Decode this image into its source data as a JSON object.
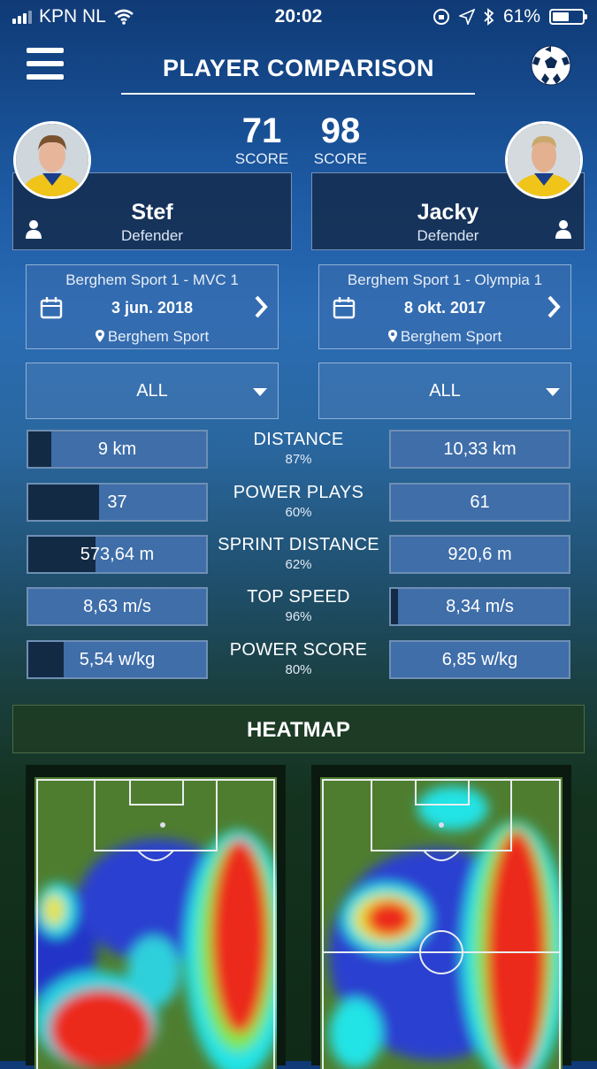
{
  "status_bar": {
    "carrier": "KPN NL",
    "time": "20:02",
    "battery": "61%",
    "battery_level": 0.61
  },
  "header": {
    "title": "PLAYER COMPARISON"
  },
  "players": [
    {
      "name": "Stef",
      "position": "Defender",
      "score": "71",
      "score_label": "SCORE",
      "match": {
        "title": "Berghem Sport 1 - MVC 1",
        "date": "3 jun. 2018",
        "location": "Berghem Sport"
      },
      "filter": "ALL"
    },
    {
      "name": "Jacky",
      "position": "Defender",
      "score": "98",
      "score_label": "SCORE",
      "match": {
        "title": "Berghem Sport 1 - Olympia 1",
        "date": "8 okt. 2017",
        "location": "Berghem Sport"
      },
      "filter": "ALL"
    }
  ],
  "stats": [
    {
      "label": "DISTANCE",
      "percent": "87%",
      "left": "9 km",
      "right": "10,33 km",
      "left_fill": 0.87,
      "right_fill": 1.0
    },
    {
      "label": "POWER PLAYS",
      "percent": "60%",
      "left": "37",
      "right": "61",
      "left_fill": 0.6,
      "right_fill": 1.0
    },
    {
      "label": "SPRINT DISTANCE",
      "percent": "62%",
      "left": "573,64 m",
      "right": "920,6 m",
      "left_fill": 0.62,
      "right_fill": 1.0
    },
    {
      "label": "TOP SPEED",
      "percent": "96%",
      "left": "8,63 m/s",
      "right": "8,34 m/s",
      "left_fill": 1.0,
      "right_fill": 0.96
    },
    {
      "label": "POWER SCORE",
      "percent": "80%",
      "left": "5,54 w/kg",
      "right": "6,85 w/kg",
      "left_fill": 0.8,
      "right_fill": 1.0
    }
  ],
  "heatmap": {
    "title": "HEATMAP"
  },
  "icons": {
    "menu": "hamburger-menu-icon",
    "ball": "soccer-ball-icon",
    "calendar": "calendar-icon",
    "chevron": "chevron-right-icon",
    "pin": "location-pin-icon",
    "person": "person-icon"
  }
}
